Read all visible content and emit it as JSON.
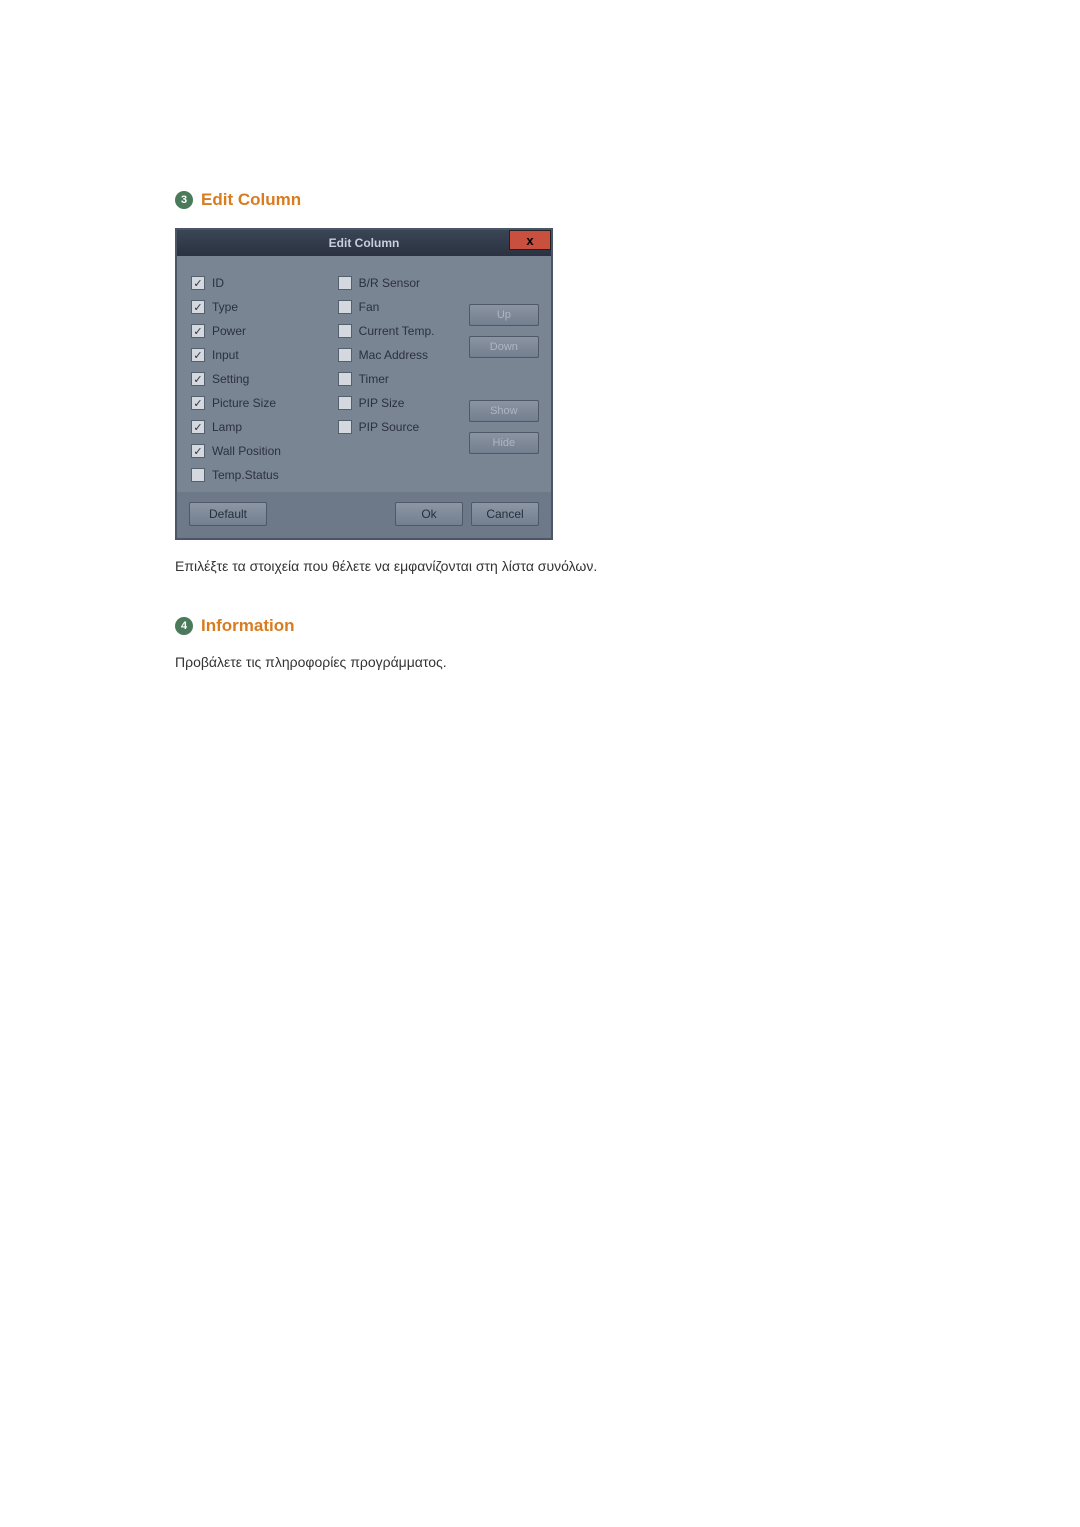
{
  "section1": {
    "num": "3",
    "title": "Edit Column",
    "description": "Επιλέξτε τα στοιχεία που θέλετε να εμφανίζονται στη λίστα συνόλων."
  },
  "section2": {
    "num": "4",
    "title": "Information",
    "description": "Προβάλετε τις πληροφορίες προγράμματος."
  },
  "dialog": {
    "title": "Edit Column",
    "close": "x",
    "col1": [
      {
        "label": "ID",
        "checked": true
      },
      {
        "label": "Type",
        "checked": true
      },
      {
        "label": "Power",
        "checked": true
      },
      {
        "label": "Input",
        "checked": true
      },
      {
        "label": "Setting",
        "checked": true
      },
      {
        "label": "Picture Size",
        "checked": true
      },
      {
        "label": "Lamp",
        "checked": true
      },
      {
        "label": "Wall Position",
        "checked": true
      },
      {
        "label": "Temp.Status",
        "checked": false
      }
    ],
    "col2": [
      {
        "label": "B/R Sensor",
        "checked": false
      },
      {
        "label": "Fan",
        "checked": false
      },
      {
        "label": "Current Temp.",
        "checked": false
      },
      {
        "label": "Mac Address",
        "checked": false
      },
      {
        "label": "Timer",
        "checked": false
      },
      {
        "label": "PIP Size",
        "checked": false
      },
      {
        "label": "PIP Source",
        "checked": false
      }
    ],
    "buttons": {
      "up": "Up",
      "down": "Down",
      "show": "Show",
      "hide": "Hide",
      "default": "Default",
      "ok": "Ok",
      "cancel": "Cancel"
    }
  }
}
